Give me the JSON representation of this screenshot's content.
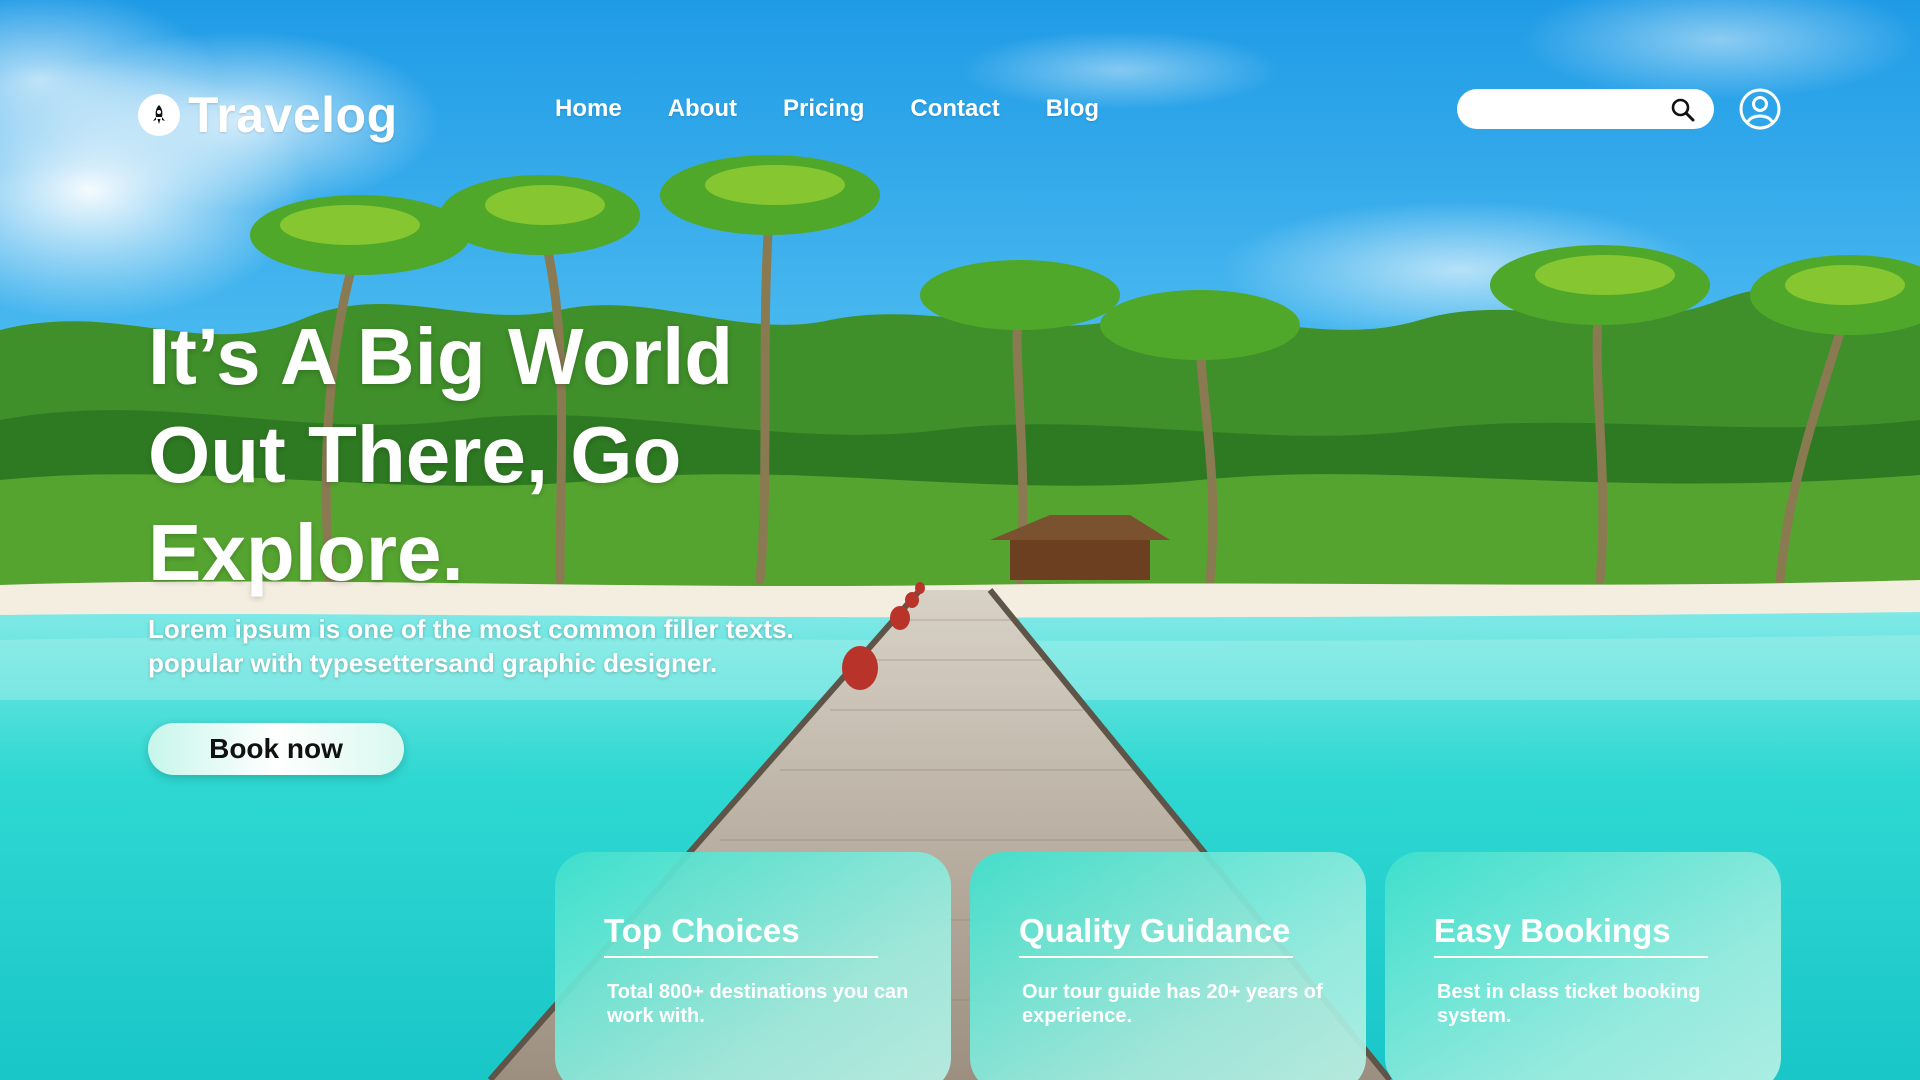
{
  "brand": {
    "name": "Travelog",
    "logo_icon": "rocket-icon"
  },
  "nav": {
    "items": [
      {
        "label": "Home"
      },
      {
        "label": "About"
      },
      {
        "label": "Pricing"
      },
      {
        "label": "Contact"
      },
      {
        "label": "Blog"
      }
    ]
  },
  "search": {
    "placeholder": "",
    "value": "",
    "icon": "search-icon"
  },
  "user": {
    "icon": "user-circle-icon"
  },
  "hero": {
    "title_lines": [
      "It’s A Big World",
      "Out There, Go",
      "Explore."
    ],
    "subtitle_lines": [
      "Lorem ipsum  is one of the most common filler texts.",
      "popular with typesettersand graphic designer."
    ],
    "cta_label": "Book now"
  },
  "features": [
    {
      "title": "Top Choices",
      "description": "Total 800+ destinations you can work with."
    },
    {
      "title": "Quality Guidance",
      "description": "Our tour guide has 20+ years of experience."
    },
    {
      "title": "Easy Bookings",
      "description": "Best in class ticket booking system."
    }
  ],
  "colors": {
    "sky": "#2aa6ea",
    "sea": "#30d8cf",
    "card": "#3fe0cc",
    "text": "#ffffff",
    "cta_text": "#111111"
  }
}
